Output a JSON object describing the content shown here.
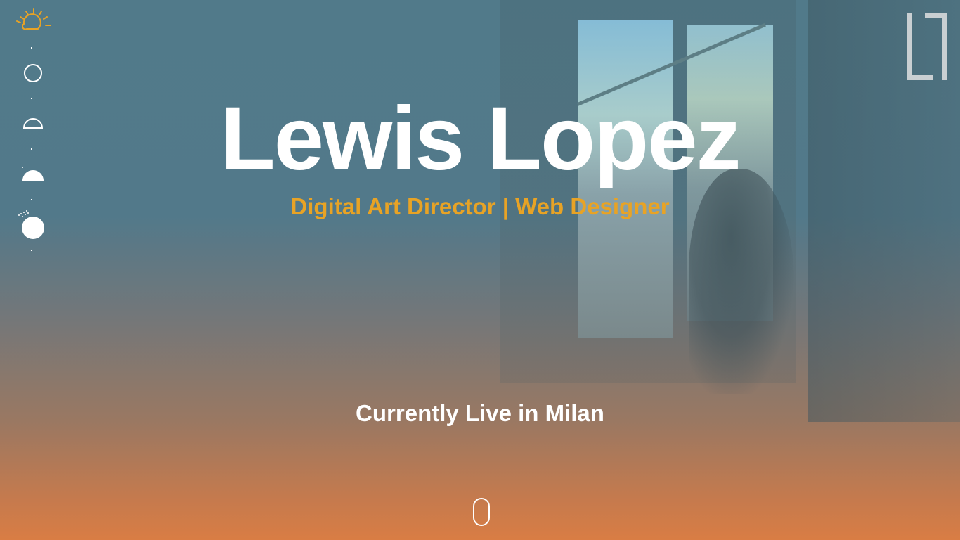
{
  "hero": {
    "name": "Lewis Lopez",
    "role": "Digital Art Director | Web Designer",
    "location": "Currently Live in Milan"
  },
  "time_nav": {
    "items": [
      {
        "icon": "sunrise-icon"
      },
      {
        "icon": "new-moon-icon"
      },
      {
        "icon": "half-moon-outline-icon"
      },
      {
        "icon": "half-moon-filled-icon"
      },
      {
        "icon": "full-moon-icon"
      }
    ]
  },
  "logo": {
    "icon": "bracket-logo-icon"
  },
  "scroll": {
    "icon": "mouse-scroll-icon"
  },
  "colors": {
    "accent": "#e8a325",
    "text": "#ffffff",
    "bg_top": "#517a8a",
    "bg_bottom": "#d97d44"
  }
}
